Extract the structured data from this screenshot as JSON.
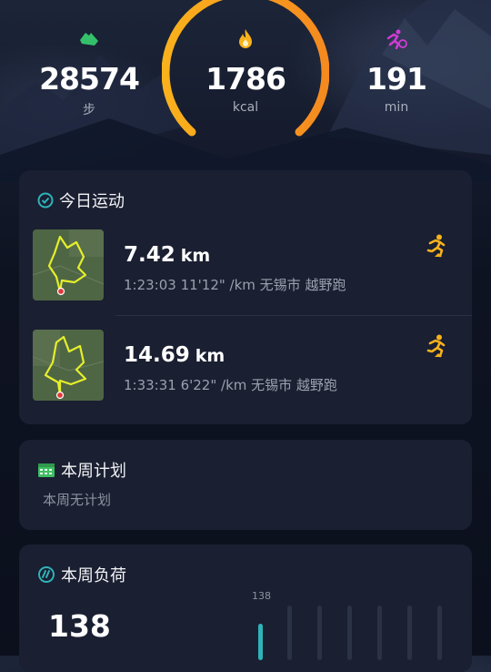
{
  "summary": {
    "steps": {
      "value": "28574",
      "unit": "步"
    },
    "calories": {
      "value": "1786",
      "unit": "kcal"
    },
    "duration": {
      "value": "191",
      "unit": "min"
    }
  },
  "today": {
    "title": "今日运动",
    "activities": [
      {
        "distance": "7.42",
        "unit": "km",
        "meta": "1:23:03  11'12\" /km 无锡市 越野跑"
      },
      {
        "distance": "14.69",
        "unit": "km",
        "meta": "1:33:31  6'22\" /km 无锡市 越野跑"
      }
    ]
  },
  "plan": {
    "title": "本周计划",
    "subtitle": "本周无计划"
  },
  "load": {
    "title": "本周负荷",
    "value": "138",
    "bar_max_label": "138"
  },
  "colors": {
    "accent_orange": "#f7a21a",
    "accent_teal": "#2fb3b8",
    "steps_green": "#34c06a",
    "minutes_magenta": "#d23ad6"
  }
}
